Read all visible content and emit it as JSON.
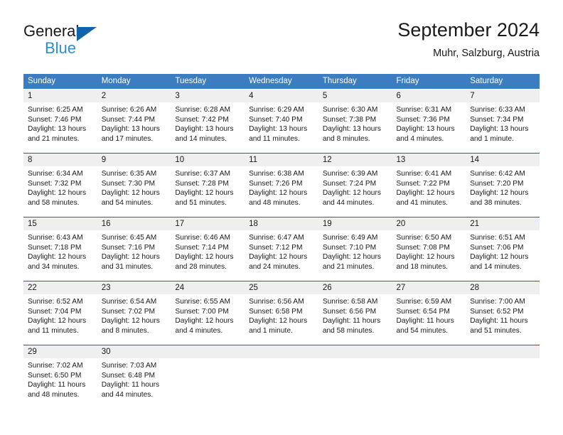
{
  "brand": {
    "line1": "General",
    "line2": "Blue",
    "triangle_color": "#1162ad",
    "blue_text_color": "#2b8fd8"
  },
  "header": {
    "title": "September 2024",
    "subtitle": "Muhr, Salzburg, Austria"
  },
  "theme": {
    "header_row_bg": "#3b7dc0",
    "date_strip_bg": "#efefef",
    "row_separator": "#1f63a8",
    "cell_bg": "#ffffff",
    "text": "#1a1a1a"
  },
  "calendar": {
    "weekday_headers": [
      "Sunday",
      "Monday",
      "Tuesday",
      "Wednesday",
      "Thursday",
      "Friday",
      "Saturday"
    ],
    "weeks": [
      {
        "dates": [
          "1",
          "2",
          "3",
          "4",
          "5",
          "6",
          "7"
        ],
        "cells": [
          {
            "sunrise": "Sunrise: 6:25 AM",
            "sunset": "Sunset: 7:46 PM",
            "daylight1": "Daylight: 13 hours",
            "daylight2": "and 21 minutes."
          },
          {
            "sunrise": "Sunrise: 6:26 AM",
            "sunset": "Sunset: 7:44 PM",
            "daylight1": "Daylight: 13 hours",
            "daylight2": "and 17 minutes."
          },
          {
            "sunrise": "Sunrise: 6:28 AM",
            "sunset": "Sunset: 7:42 PM",
            "daylight1": "Daylight: 13 hours",
            "daylight2": "and 14 minutes."
          },
          {
            "sunrise": "Sunrise: 6:29 AM",
            "sunset": "Sunset: 7:40 PM",
            "daylight1": "Daylight: 13 hours",
            "daylight2": "and 11 minutes."
          },
          {
            "sunrise": "Sunrise: 6:30 AM",
            "sunset": "Sunset: 7:38 PM",
            "daylight1": "Daylight: 13 hours",
            "daylight2": "and 8 minutes."
          },
          {
            "sunrise": "Sunrise: 6:31 AM",
            "sunset": "Sunset: 7:36 PM",
            "daylight1": "Daylight: 13 hours",
            "daylight2": "and 4 minutes."
          },
          {
            "sunrise": "Sunrise: 6:33 AM",
            "sunset": "Sunset: 7:34 PM",
            "daylight1": "Daylight: 13 hours",
            "daylight2": "and 1 minute."
          }
        ]
      },
      {
        "dates": [
          "8",
          "9",
          "10",
          "11",
          "12",
          "13",
          "14"
        ],
        "cells": [
          {
            "sunrise": "Sunrise: 6:34 AM",
            "sunset": "Sunset: 7:32 PM",
            "daylight1": "Daylight: 12 hours",
            "daylight2": "and 58 minutes."
          },
          {
            "sunrise": "Sunrise: 6:35 AM",
            "sunset": "Sunset: 7:30 PM",
            "daylight1": "Daylight: 12 hours",
            "daylight2": "and 54 minutes."
          },
          {
            "sunrise": "Sunrise: 6:37 AM",
            "sunset": "Sunset: 7:28 PM",
            "daylight1": "Daylight: 12 hours",
            "daylight2": "and 51 minutes."
          },
          {
            "sunrise": "Sunrise: 6:38 AM",
            "sunset": "Sunset: 7:26 PM",
            "daylight1": "Daylight: 12 hours",
            "daylight2": "and 48 minutes."
          },
          {
            "sunrise": "Sunrise: 6:39 AM",
            "sunset": "Sunset: 7:24 PM",
            "daylight1": "Daylight: 12 hours",
            "daylight2": "and 44 minutes."
          },
          {
            "sunrise": "Sunrise: 6:41 AM",
            "sunset": "Sunset: 7:22 PM",
            "daylight1": "Daylight: 12 hours",
            "daylight2": "and 41 minutes."
          },
          {
            "sunrise": "Sunrise: 6:42 AM",
            "sunset": "Sunset: 7:20 PM",
            "daylight1": "Daylight: 12 hours",
            "daylight2": "and 38 minutes."
          }
        ]
      },
      {
        "dates": [
          "15",
          "16",
          "17",
          "18",
          "19",
          "20",
          "21"
        ],
        "cells": [
          {
            "sunrise": "Sunrise: 6:43 AM",
            "sunset": "Sunset: 7:18 PM",
            "daylight1": "Daylight: 12 hours",
            "daylight2": "and 34 minutes."
          },
          {
            "sunrise": "Sunrise: 6:45 AM",
            "sunset": "Sunset: 7:16 PM",
            "daylight1": "Daylight: 12 hours",
            "daylight2": "and 31 minutes."
          },
          {
            "sunrise": "Sunrise: 6:46 AM",
            "sunset": "Sunset: 7:14 PM",
            "daylight1": "Daylight: 12 hours",
            "daylight2": "and 28 minutes."
          },
          {
            "sunrise": "Sunrise: 6:47 AM",
            "sunset": "Sunset: 7:12 PM",
            "daylight1": "Daylight: 12 hours",
            "daylight2": "and 24 minutes."
          },
          {
            "sunrise": "Sunrise: 6:49 AM",
            "sunset": "Sunset: 7:10 PM",
            "daylight1": "Daylight: 12 hours",
            "daylight2": "and 21 minutes."
          },
          {
            "sunrise": "Sunrise: 6:50 AM",
            "sunset": "Sunset: 7:08 PM",
            "daylight1": "Daylight: 12 hours",
            "daylight2": "and 18 minutes."
          },
          {
            "sunrise": "Sunrise: 6:51 AM",
            "sunset": "Sunset: 7:06 PM",
            "daylight1": "Daylight: 12 hours",
            "daylight2": "and 14 minutes."
          }
        ]
      },
      {
        "dates": [
          "22",
          "23",
          "24",
          "25",
          "26",
          "27",
          "28"
        ],
        "cells": [
          {
            "sunrise": "Sunrise: 6:52 AM",
            "sunset": "Sunset: 7:04 PM",
            "daylight1": "Daylight: 12 hours",
            "daylight2": "and 11 minutes."
          },
          {
            "sunrise": "Sunrise: 6:54 AM",
            "sunset": "Sunset: 7:02 PM",
            "daylight1": "Daylight: 12 hours",
            "daylight2": "and 8 minutes."
          },
          {
            "sunrise": "Sunrise: 6:55 AM",
            "sunset": "Sunset: 7:00 PM",
            "daylight1": "Daylight: 12 hours",
            "daylight2": "and 4 minutes."
          },
          {
            "sunrise": "Sunrise: 6:56 AM",
            "sunset": "Sunset: 6:58 PM",
            "daylight1": "Daylight: 12 hours",
            "daylight2": "and 1 minute."
          },
          {
            "sunrise": "Sunrise: 6:58 AM",
            "sunset": "Sunset: 6:56 PM",
            "daylight1": "Daylight: 11 hours",
            "daylight2": "and 58 minutes."
          },
          {
            "sunrise": "Sunrise: 6:59 AM",
            "sunset": "Sunset: 6:54 PM",
            "daylight1": "Daylight: 11 hours",
            "daylight2": "and 54 minutes."
          },
          {
            "sunrise": "Sunrise: 7:00 AM",
            "sunset": "Sunset: 6:52 PM",
            "daylight1": "Daylight: 11 hours",
            "daylight2": "and 51 minutes."
          }
        ]
      },
      {
        "dates": [
          "29",
          "30",
          "",
          "",
          "",
          "",
          ""
        ],
        "cells": [
          {
            "sunrise": "Sunrise: 7:02 AM",
            "sunset": "Sunset: 6:50 PM",
            "daylight1": "Daylight: 11 hours",
            "daylight2": "and 48 minutes."
          },
          {
            "sunrise": "Sunrise: 7:03 AM",
            "sunset": "Sunset: 6:48 PM",
            "daylight1": "Daylight: 11 hours",
            "daylight2": "and 44 minutes."
          },
          {
            "sunrise": "",
            "sunset": "",
            "daylight1": "",
            "daylight2": ""
          },
          {
            "sunrise": "",
            "sunset": "",
            "daylight1": "",
            "daylight2": ""
          },
          {
            "sunrise": "",
            "sunset": "",
            "daylight1": "",
            "daylight2": ""
          },
          {
            "sunrise": "",
            "sunset": "",
            "daylight1": "",
            "daylight2": ""
          },
          {
            "sunrise": "",
            "sunset": "",
            "daylight1": "",
            "daylight2": ""
          }
        ]
      }
    ]
  }
}
